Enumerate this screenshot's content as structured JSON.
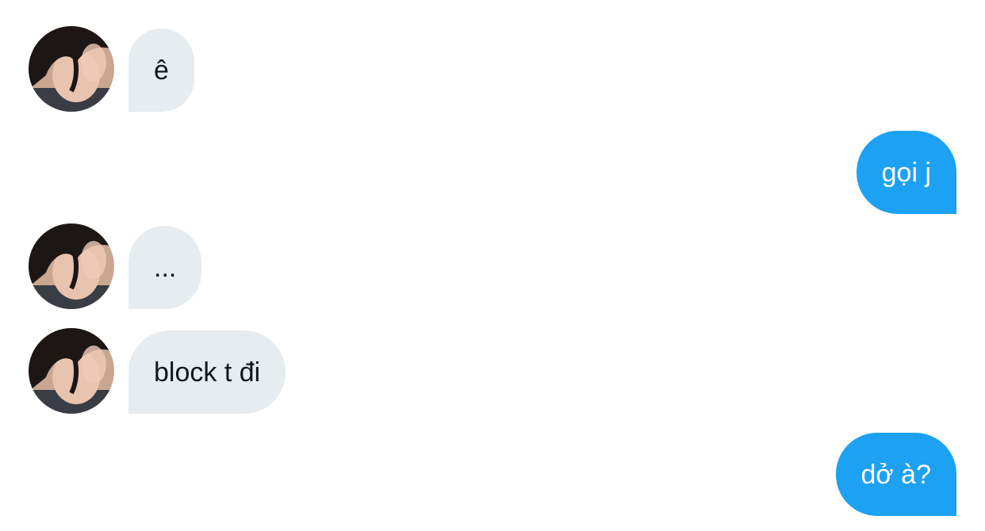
{
  "conversation": {
    "messages": [
      {
        "direction": "incoming",
        "text": "ê"
      },
      {
        "direction": "outgoing",
        "text": "gọi j"
      },
      {
        "direction": "incoming",
        "text": "..."
      },
      {
        "direction": "incoming",
        "text": "block t đi"
      },
      {
        "direction": "outgoing",
        "text": "dở à?"
      }
    ]
  },
  "colors": {
    "incoming_bubble": "#e6ecf0",
    "outgoing_bubble": "#1da1f2",
    "incoming_text": "#14171a",
    "outgoing_text": "#ffffff"
  },
  "avatar_icon": "user-photo-avatar"
}
